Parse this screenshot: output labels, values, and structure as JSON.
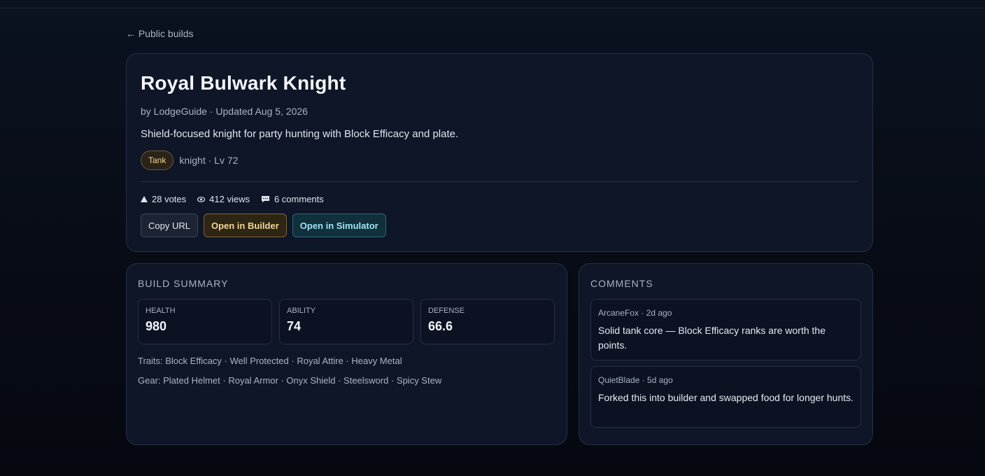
{
  "nav": {
    "back_label": "← Public builds"
  },
  "build": {
    "title": "Royal Bulwark Knight",
    "meta": "by LodgeGuide · Updated Aug 5, 2026",
    "description": "Shield-focused knight for party hunting with Block Efficacy and plate.",
    "role": "Tank",
    "class_level": "knight · Lv 72",
    "votes": "28 votes",
    "views": "412 views",
    "comments_count": "6 comments"
  },
  "actions": {
    "copy_url": "Copy URL",
    "open_builder": "Open in Builder",
    "open_simulator": "Open in Simulator"
  },
  "summary": {
    "title": "Build Summary",
    "stats": [
      {
        "label": "Health",
        "value": "980"
      },
      {
        "label": "Ability",
        "value": "74"
      },
      {
        "label": "Defense",
        "value": "66.6"
      }
    ],
    "traits": "Traits: Block Efficacy · Well Protected · Royal Attire · Heavy Metal",
    "gear": "Gear: Plated Helmet · Royal Armor · Onyx Shield · Steelsword · Spicy Stew"
  },
  "comments": {
    "title": "Comments",
    "items": [
      {
        "meta": "ArcaneFox · 2d ago",
        "body": "Solid tank core — Block Efficacy ranks are worth the points."
      },
      {
        "meta": "QuietBlade · 5d ago",
        "body": "Forked this into builder and swapped food for longer hunts."
      }
    ]
  },
  "icons": {
    "votes": "upvote-triangle-icon",
    "views": "eye-icon",
    "comments": "speech-bubble-icon"
  },
  "colors": {
    "background": "#070b14",
    "panel": "#0f1628",
    "accent_gold": "#f2d694",
    "accent_cyan": "#9fe3f5"
  }
}
